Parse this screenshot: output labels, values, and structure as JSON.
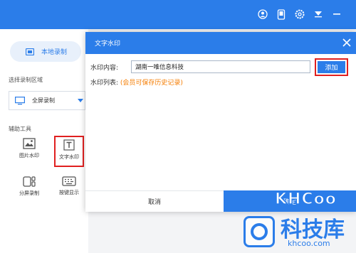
{
  "left_panel": {
    "local_record_tab": "本地录制",
    "select_region_title": "选择录制区域",
    "region_select_value": "全屏录制",
    "tools_title": "辅助工具",
    "tools": [
      {
        "label": "图片水印",
        "icon": "image-icon"
      },
      {
        "label": "文字水印",
        "icon": "text-t-icon"
      },
      {
        "label": "分屏录制",
        "icon": "split-screen-icon"
      },
      {
        "label": "按键显示",
        "icon": "keyboard-icon"
      }
    ]
  },
  "top_icons": [
    "user-icon",
    "phone-icon",
    "settings-icon",
    "dropdown-icon",
    "minimize-icon"
  ],
  "dialog": {
    "title": "文字水印",
    "content_label": "水印内容:",
    "content_value": "湖南一唯信息科技",
    "add_button": "添加",
    "list_label": "水印列表:",
    "vip_note": "(会员可保存历史记录)",
    "cancel_button": "取消",
    "confirm_button": "确定"
  },
  "watermark": {
    "brand": "KHCoo",
    "name": "科技库",
    "site": "khcoo.com"
  },
  "colors": {
    "primary": "#2b7de9",
    "highlight_red": "#e02020",
    "note_orange": "#f57c00"
  }
}
